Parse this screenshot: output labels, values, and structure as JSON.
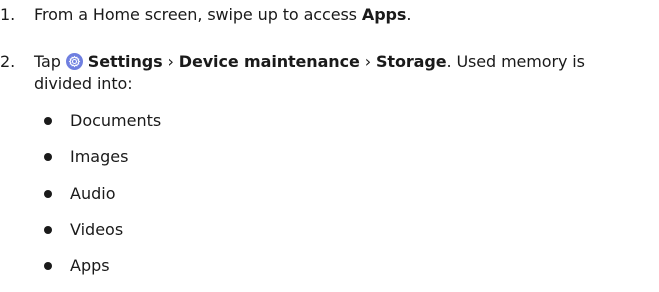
{
  "steps": [
    {
      "number": "1.",
      "parts": {
        "pre": "From a Home screen, swipe up to access ",
        "apps": "Apps",
        "post": "."
      }
    },
    {
      "number": "2.",
      "parts": {
        "pre": "Tap ",
        "settings": "Settings",
        "sep1": " › ",
        "device_maintenance": "Device maintenance",
        "sep2": " › ",
        "storage": "Storage",
        "post_line1": ". Used memory is",
        "post_line2": "divided into:"
      },
      "icon": "settings-gear-icon",
      "icon_color": "#6f7fe0"
    }
  ],
  "bullets": [
    "Documents",
    "Images",
    "Audio",
    "Videos",
    "Apps"
  ]
}
